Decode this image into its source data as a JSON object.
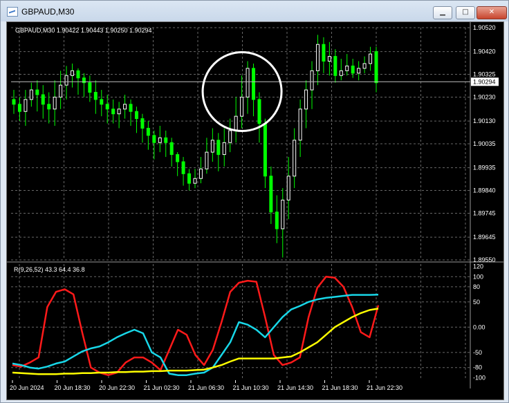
{
  "window": {
    "title": "GBPAUD,M30",
    "minimize_icon": "minimize-icon",
    "maximize_icon": "maximize-icon",
    "close_icon": "close-icon",
    "minimize_label": "▁",
    "maximize_label": "□",
    "close_label": "✕"
  },
  "colors": {
    "background": "#000000",
    "grid": "#686868",
    "candle_up": "#ffffff",
    "candle_down": "#00ff00",
    "circle": "#ffffff",
    "line_red": "#ff1a1a",
    "line_cyan": "#18d7e8",
    "line_yellow": "#ffff00"
  },
  "chart_data": [
    {
      "type": "candlestick",
      "header": "GBPAUD,M30  1.90422 1.90443 1.90250 1.90294",
      "current_price": 1.90294,
      "current_price_label": "1.90294",
      "ylim": [
        1.8955,
        1.9052
      ],
      "y_ticks": [
        1.9052,
        1.9042,
        1.90325,
        1.9023,
        1.9013,
        1.90035,
        1.89935,
        1.8984,
        1.89745,
        1.89645,
        1.8955
      ],
      "y_tick_labels": [
        "1.90520",
        "1.90420",
        "1.90325",
        "1.90230",
        "1.90130",
        "1.90035",
        "1.89935",
        "1.89840",
        "1.89745",
        "1.89645",
        "1.89550"
      ],
      "annotation": "white circle around 21 Jun ~10:00 high",
      "candles": [
        [
          1.9022,
          1.902,
          1.9026,
          1.9016
        ],
        [
          1.902,
          1.9017,
          1.9023,
          1.9013
        ],
        [
          1.9017,
          1.9022,
          1.9026,
          1.9011
        ],
        [
          1.9022,
          1.9026,
          1.9029,
          1.9019
        ],
        [
          1.9026,
          1.9024,
          1.903,
          1.9017
        ],
        [
          1.9024,
          1.902,
          1.9028,
          1.9014
        ],
        [
          1.902,
          1.9018,
          1.9025,
          1.9012
        ],
        [
          1.9018,
          1.9023,
          1.903,
          1.9011
        ],
        [
          1.9023,
          1.9028,
          1.9034,
          1.9018
        ],
        [
          1.9028,
          1.9032,
          1.9036,
          1.9022
        ],
        [
          1.9032,
          1.9034,
          1.9037,
          1.9027
        ],
        [
          1.9034,
          1.9031,
          1.9035,
          1.9024
        ],
        [
          1.9031,
          1.9029,
          1.9033,
          1.9023
        ],
        [
          1.9029,
          1.9025,
          1.9032,
          1.9021
        ],
        [
          1.9025,
          1.9022,
          1.903,
          1.9016
        ],
        [
          1.9022,
          1.902,
          1.9026,
          1.9015
        ],
        [
          1.902,
          1.9018,
          1.9024,
          1.9012
        ],
        [
          1.9018,
          1.9016,
          1.9022,
          1.9012
        ],
        [
          1.9016,
          1.9018,
          1.9021,
          1.901
        ],
        [
          1.9018,
          1.902,
          1.9024,
          1.9014
        ],
        [
          1.902,
          1.9017,
          1.9022,
          1.9011
        ],
        [
          1.9017,
          1.9014,
          1.9019,
          1.9008
        ],
        [
          1.9014,
          1.901,
          1.9016,
          1.9004
        ],
        [
          1.901,
          1.9007,
          1.9013,
          1.9001
        ],
        [
          1.9007,
          1.9004,
          1.9009,
          1.8997
        ],
        [
          1.9004,
          1.9006,
          1.9011,
          1.9
        ],
        [
          1.9006,
          1.9004,
          1.9009,
          1.8998
        ],
        [
          1.9004,
          1.8999,
          1.9006,
          1.8994
        ],
        [
          1.8999,
          1.8996,
          1.9,
          1.899
        ],
        [
          1.8996,
          1.8991,
          1.8998,
          1.8986
        ],
        [
          1.8991,
          1.8987,
          1.8993,
          1.8984
        ],
        [
          1.8987,
          1.8989,
          1.8993,
          1.8985
        ],
        [
          1.8989,
          1.8993,
          1.8998,
          1.8987
        ],
        [
          1.8993,
          1.9,
          1.9006,
          1.8991
        ],
        [
          1.9,
          1.9005,
          1.901,
          1.8996
        ],
        [
          1.9005,
          1.8999,
          1.9008,
          1.8992
        ],
        [
          1.8999,
          1.9004,
          1.901,
          1.8994
        ],
        [
          1.9004,
          1.9009,
          1.9014,
          1.9
        ],
        [
          1.9009,
          1.9015,
          1.9023,
          1.9004
        ],
        [
          1.9015,
          1.9023,
          1.9032,
          1.901
        ],
        [
          1.9023,
          1.9035,
          1.9038,
          1.9016
        ],
        [
          1.9035,
          1.9022,
          1.9037,
          1.9015
        ],
        [
          1.9022,
          1.9012,
          1.9025,
          1.9004
        ],
        [
          1.9012,
          1.899,
          1.9014,
          1.8985
        ],
        [
          1.899,
          1.8975,
          1.8994,
          1.897
        ],
        [
          1.8975,
          1.8968,
          1.8982,
          1.8962
        ],
        [
          1.8968,
          1.898,
          1.8985,
          1.8956
        ],
        [
          1.898,
          1.899,
          1.8998,
          1.8972
        ],
        [
          1.899,
          1.9005,
          1.901,
          1.8985
        ],
        [
          1.9005,
          1.9018,
          1.9022,
          1.8998
        ],
        [
          1.9018,
          1.9026,
          1.903,
          1.901
        ],
        [
          1.9026,
          1.9034,
          1.9038,
          1.9018
        ],
        [
          1.9034,
          1.9045,
          1.9049,
          1.9028
        ],
        [
          1.9045,
          1.9038,
          1.9048,
          1.9033
        ],
        [
          1.9038,
          1.904,
          1.9046,
          1.9032
        ],
        [
          1.904,
          1.9032,
          1.9043,
          1.9029
        ],
        [
          1.9032,
          1.9034,
          1.9039,
          1.903
        ],
        [
          1.9034,
          1.9036,
          1.9041,
          1.9032
        ],
        [
          1.9036,
          1.9033,
          1.9039,
          1.9031
        ],
        [
          1.9033,
          1.9035,
          1.9038,
          1.903
        ],
        [
          1.9035,
          1.9037,
          1.904,
          1.9033
        ],
        [
          1.9037,
          1.9041,
          1.9044,
          1.9034
        ],
        [
          1.9042,
          1.9029,
          1.9044,
          1.9025
        ]
      ]
    },
    {
      "type": "line",
      "header": "R(9,26,52) 43.3 64.4 36.8",
      "ylim": [
        -105,
        125
      ],
      "y_ticks": [
        120,
        100,
        80,
        50,
        0,
        -50,
        -80,
        -100
      ],
      "y_tick_labels": [
        "120",
        "100",
        "80",
        "50",
        "0.00",
        "-50",
        "-80",
        "-100"
      ],
      "x_tick_labels": [
        "20 Jun 2024",
        "20 Jun 18:30",
        "20 Jun 22:30",
        "21 Jun 02:30",
        "21 Jun 06:30",
        "21 Jun 10:30",
        "21 Jun 14:30",
        "21 Jun 18:30",
        "21 Jun 22:30"
      ],
      "series": [
        {
          "values": [
            -75,
            -78,
            -70,
            -60,
            40,
            70,
            75,
            65,
            -10,
            -80,
            -90,
            -95,
            -90,
            -70,
            -60,
            -60,
            -70,
            -85,
            -45,
            -5,
            -15,
            -55,
            -75,
            -45,
            10,
            70,
            88,
            92,
            90,
            20,
            -55,
            -75,
            -70,
            -60,
            20,
            78,
            100,
            98,
            80,
            40,
            -10,
            -20,
            43.3
          ]
        },
        {
          "values": [
            -72,
            -75,
            -80,
            -82,
            -78,
            -72,
            -68,
            -58,
            -48,
            -42,
            -38,
            -30,
            -20,
            -12,
            -5,
            -12,
            -50,
            -60,
            -92,
            -95,
            -95,
            -92,
            -90,
            -80,
            -55,
            -30,
            10,
            5,
            -5,
            -20,
            0,
            20,
            35,
            42,
            50,
            55,
            58,
            60,
            62,
            64,
            64,
            64,
            64.4
          ]
        },
        {
          "values": [
            -90,
            -91,
            -92,
            -93,
            -93,
            -93,
            -92,
            -92,
            -91,
            -91,
            -90,
            -90,
            -89,
            -89,
            -88,
            -88,
            -87,
            -87,
            -86,
            -86,
            -86,
            -85,
            -84,
            -80,
            -75,
            -68,
            -62,
            -62,
            -62,
            -62,
            -62,
            -60,
            -58,
            -50,
            -40,
            -30,
            -15,
            0,
            10,
            20,
            28,
            34,
            36.8
          ]
        }
      ]
    }
  ]
}
